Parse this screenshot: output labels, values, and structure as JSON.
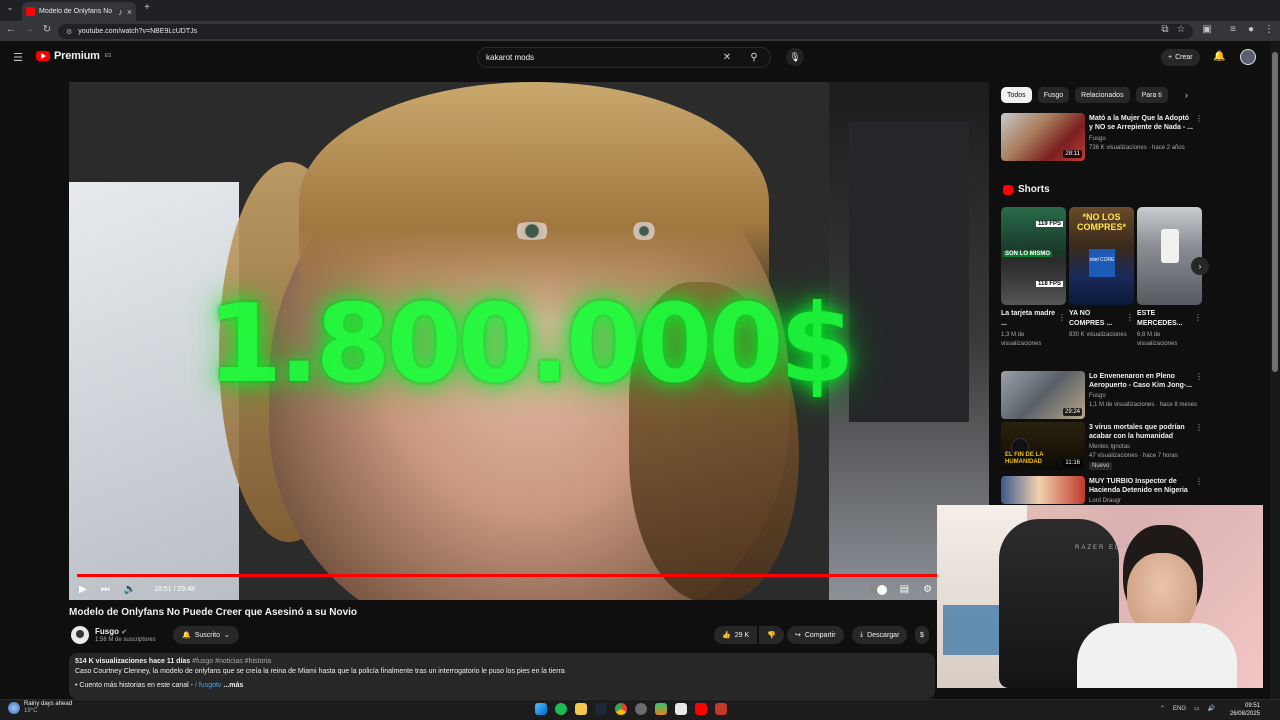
{
  "browser": {
    "tab_title": "Modelo de Onlyfans No Pu",
    "url": "youtube.com/watch?v=NBE9LcUDTJs"
  },
  "header": {
    "logo_text": "Premium",
    "logo_sup": "ES",
    "search_value": "kakarot mods",
    "create_label": "Crear"
  },
  "player": {
    "overlay_text": "1.800.000$",
    "time": "28:51 / 29:48",
    "progress": 0.968
  },
  "video": {
    "title": "Modelo de Onlyfans No Puede Creer que Asesinó a su Novio",
    "channel": "Fusgo",
    "subscribers": "1,56 M de suscriptores",
    "subscribed_label": "Suscrito",
    "likes": "29 K",
    "share_label": "Compartir",
    "download_label": "Descargar"
  },
  "description": {
    "views_date": "514 K visualizaciones  hace 11 días",
    "hashtags": "#fusgo #noticias #historia",
    "text": "Caso Courtney Clenney, la modelo de onlyfans que se creía la reina de Miami hasta que la policía finalmente tras un interrogatorio le puso los pies en la tierra",
    "line3": "• Cuento más historias en este canal - ",
    "handle": "/ fusgotv",
    "more": "...más"
  },
  "chips": [
    "Todos",
    "Fusgo",
    "Relacionados",
    "Para ti"
  ],
  "recs": [
    {
      "title": "Mató a la Mujer Que la Adoptó y NO se Arrepiente de Nada - ...",
      "channel": "Fusgo",
      "meta": "736 K visualizaciones · hace 2 años",
      "duration": "28:11"
    },
    {
      "title": "Lo Envenenaron en Pleno Aeropuerto - Caso Kim Jong-...",
      "channel": "Fusgo",
      "meta": "1,1 M de visualizaciones · hace 8 meses",
      "duration": "29:24"
    },
    {
      "title": "3 virus mortales que podrían acabar con la humanidad",
      "channel": "Mentes Ignotas",
      "meta": "47 visualizaciones · hace 7 horas",
      "duration": "11:16",
      "badge": "Nuevo",
      "thumb_text": "EL FIN DE LA HUMANIDAD"
    },
    {
      "title": "MUY TURBIO Inspector de Hacienda Detenido en Nigeria",
      "channel": "Lord Draugr",
      "meta": "",
      "duration": ""
    }
  ],
  "shorts": {
    "heading": "Shorts",
    "items": [
      {
        "title": "La tarjeta madre ...",
        "views": "1,3 M de visualizaciones",
        "t1": "119 FPS",
        "t2": "SON LO MISMO",
        "t3": "118 FPS"
      },
      {
        "title": "YA NO COMPRES ...",
        "views": "830 K visualizaciones",
        "t1": "*NO LOS COMPRES*",
        "t2": "intel CORE"
      },
      {
        "title": "ESTE MERCEDES...",
        "views": "6,8 M de visualizaciones"
      }
    ]
  },
  "webcam": {
    "brand": "RAZER EDITION"
  },
  "taskbar": {
    "weather_1": "Rainy days ahead",
    "weather_2": "19°C",
    "lang": "ENG",
    "time": "09:51",
    "date": "26/08/2025"
  },
  "colors": {
    "brand_red": "#ff0000",
    "overlay_green": "#1aff3a"
  }
}
